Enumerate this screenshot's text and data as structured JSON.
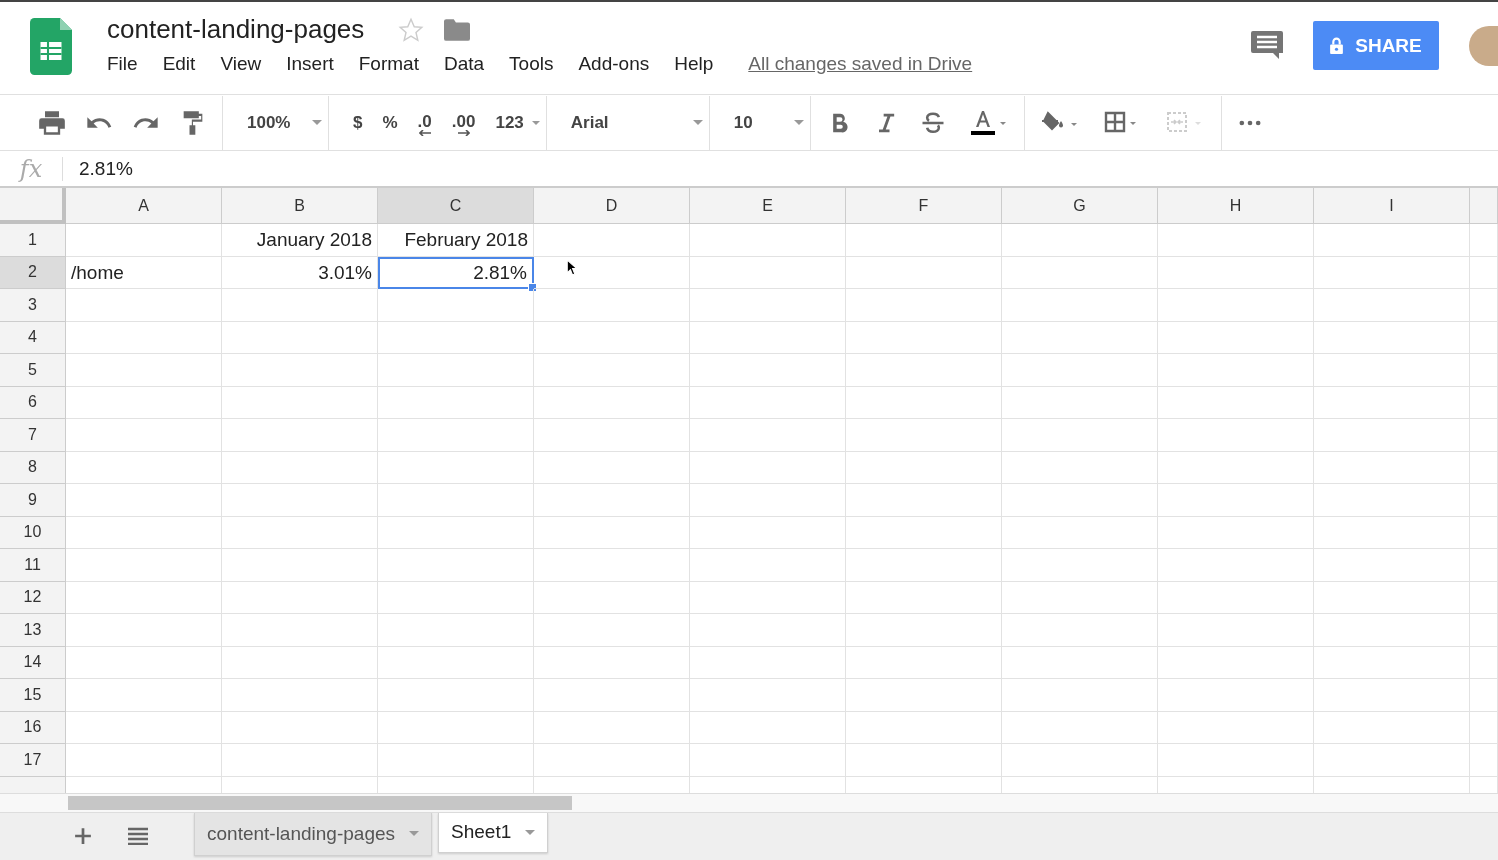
{
  "app": {
    "title": "content-landing-pages",
    "starred": false,
    "menu": [
      "File",
      "Edit",
      "View",
      "Insert",
      "Format",
      "Data",
      "Tools",
      "Add-ons",
      "Help"
    ],
    "save_status": "All changes saved in Drive",
    "share_label": "SHARE"
  },
  "toolbar": {
    "zoom": "100%",
    "currency": "$",
    "percent": "%",
    "decrease_decimals": ".0",
    "increase_decimals": ".00",
    "more_formats": "123",
    "font": "Arial",
    "font_size": "10"
  },
  "formula_bar": {
    "fx": "fx",
    "value": "2.81%"
  },
  "sheet": {
    "columns": [
      {
        "label": "A",
        "selected": false
      },
      {
        "label": "B",
        "selected": false
      },
      {
        "label": "C",
        "selected": true
      },
      {
        "label": "D",
        "selected": false
      },
      {
        "label": "E",
        "selected": false
      },
      {
        "label": "F",
        "selected": false
      },
      {
        "label": "G",
        "selected": false
      },
      {
        "label": "H",
        "selected": false
      },
      {
        "label": "I",
        "selected": false
      }
    ],
    "rows": [
      {
        "label": "1",
        "selected": false,
        "cells": [
          {
            "text": "",
            "kind": "text",
            "selected": false
          },
          {
            "text": "January 2018",
            "kind": "date",
            "selected": false
          },
          {
            "text": "February 2018",
            "kind": "date",
            "selected": false
          }
        ]
      },
      {
        "label": "2",
        "selected": true,
        "cells": [
          {
            "text": "/home",
            "kind": "text",
            "selected": false
          },
          {
            "text": "3.01%",
            "kind": "number",
            "selected": false
          },
          {
            "text": "2.81%",
            "kind": "number",
            "selected": true
          }
        ]
      },
      {
        "label": "3",
        "selected": false,
        "cells": []
      },
      {
        "label": "4",
        "selected": false,
        "cells": []
      },
      {
        "label": "5",
        "selected": false,
        "cells": []
      },
      {
        "label": "6",
        "selected": false,
        "cells": []
      },
      {
        "label": "7",
        "selected": false,
        "cells": []
      },
      {
        "label": "8",
        "selected": false,
        "cells": []
      },
      {
        "label": "9",
        "selected": false,
        "cells": []
      },
      {
        "label": "10",
        "selected": false,
        "cells": []
      },
      {
        "label": "11",
        "selected": false,
        "cells": []
      },
      {
        "label": "12",
        "selected": false,
        "cells": []
      },
      {
        "label": "13",
        "selected": false,
        "cells": []
      },
      {
        "label": "14",
        "selected": false,
        "cells": []
      },
      {
        "label": "15",
        "selected": false,
        "cells": []
      },
      {
        "label": "16",
        "selected": false,
        "cells": []
      },
      {
        "label": "17",
        "selected": false,
        "cells": []
      }
    ]
  },
  "sheet_tabs": [
    {
      "label": "content-landing-pages",
      "selected": false
    },
    {
      "label": "Sheet1",
      "selected": true
    }
  ]
}
